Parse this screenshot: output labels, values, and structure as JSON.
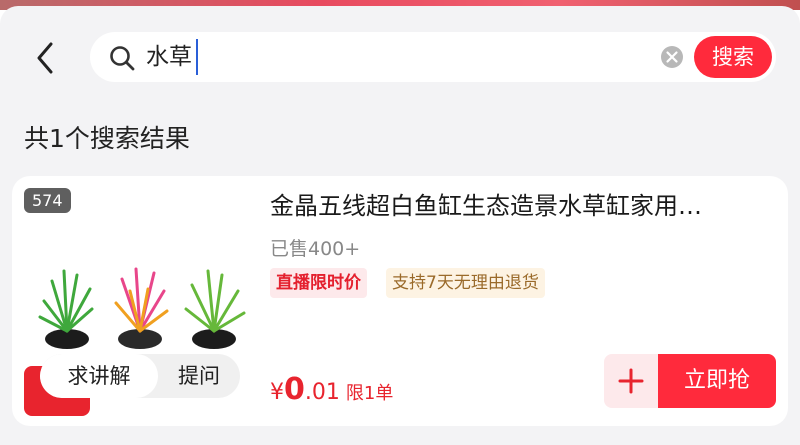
{
  "search": {
    "query": "水草",
    "button_label": "搜索"
  },
  "results": {
    "count_text": "共1个搜索结果"
  },
  "product": {
    "thumb_number": "574",
    "title": "金晶五线超白鱼缸生态造景水草缸家用…",
    "sold": "已售400+",
    "tag_live": "直播限时价",
    "tag_return": "支持7天无理由退货",
    "price_symbol": "¥",
    "price_int": "0",
    "price_dec": ".01",
    "limit": "限1单",
    "explain_label": "求讲解",
    "ask_label": "提问",
    "buy_label": "立即抢"
  },
  "colors": {
    "accent": "#ff2a3c",
    "price": "#e8242e"
  },
  "icons": [
    "back-arrow-icon",
    "search-icon",
    "clear-icon",
    "plus-icon"
  ]
}
